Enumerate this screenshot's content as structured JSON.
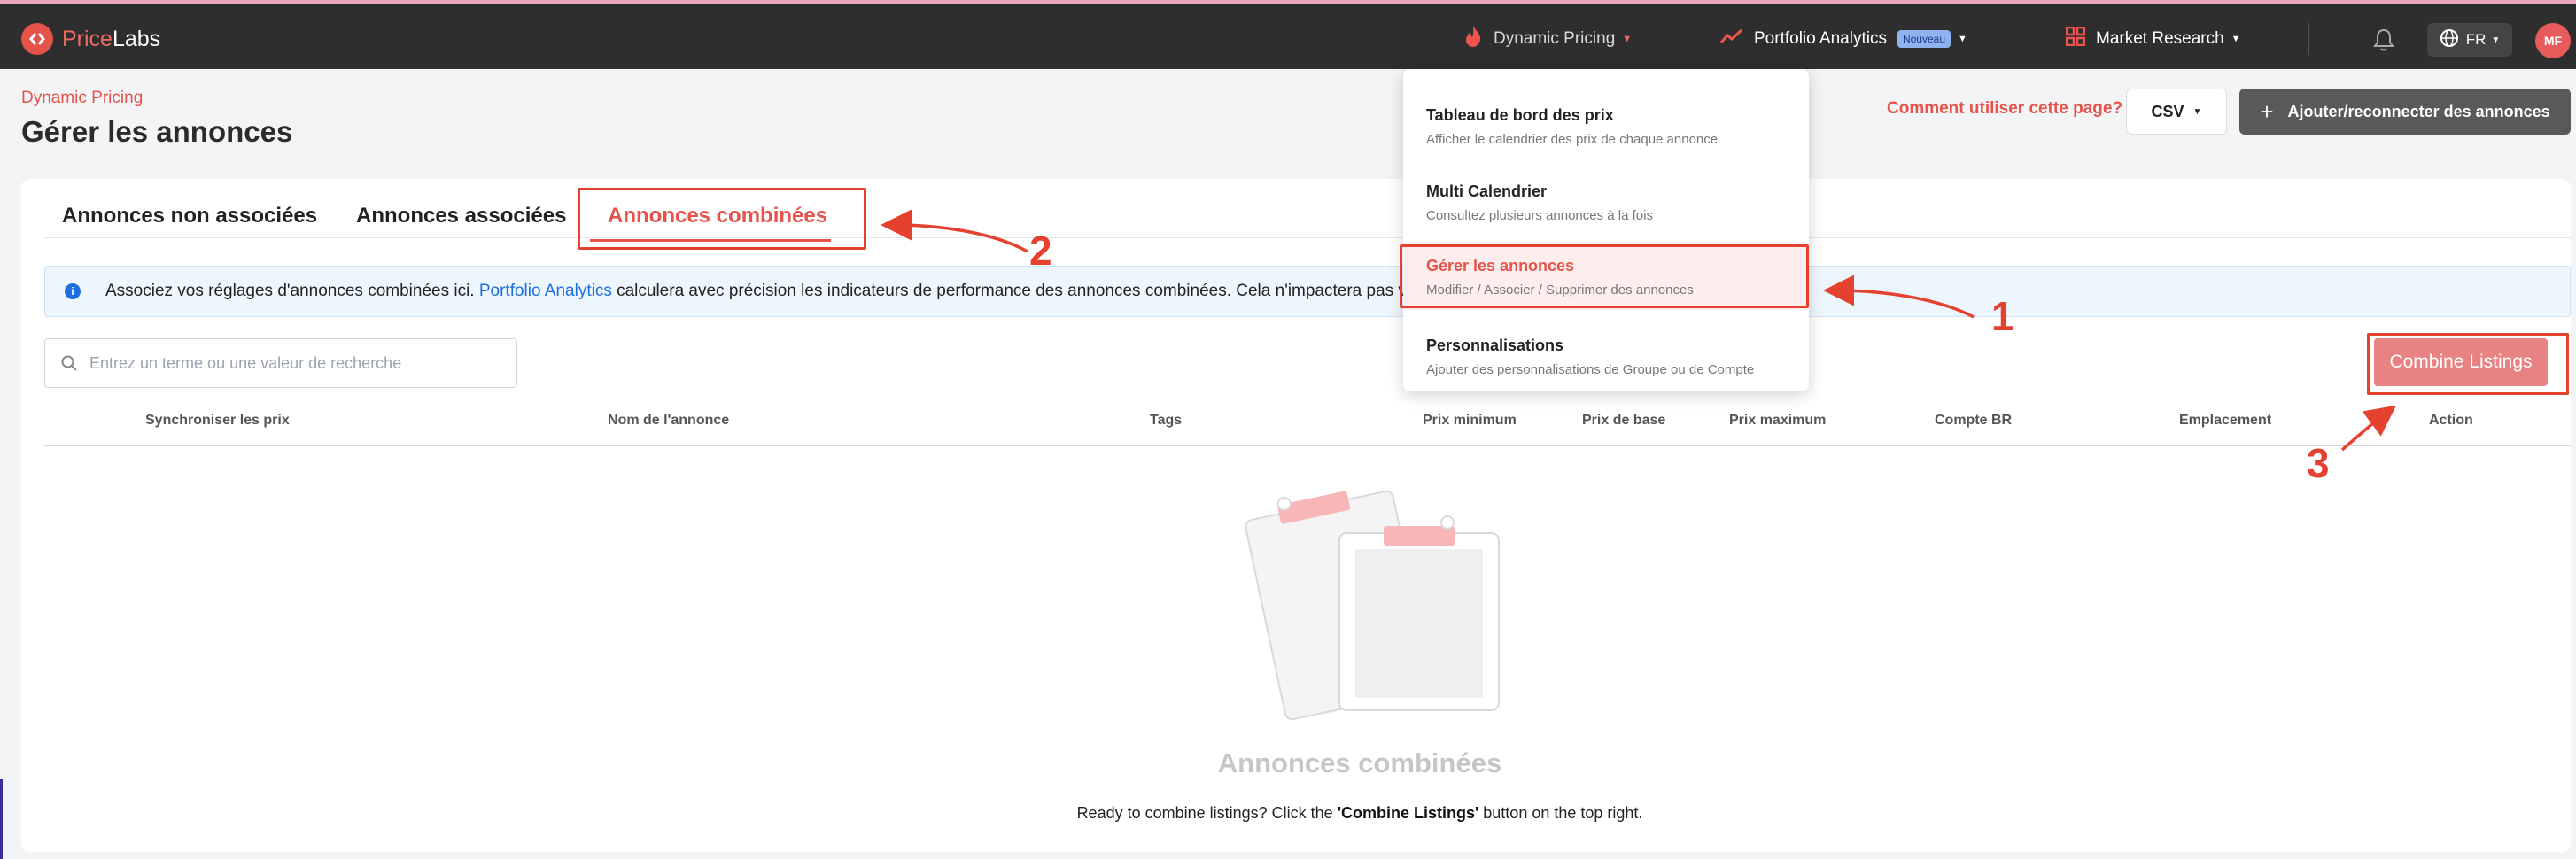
{
  "brand": {
    "name_prefix": "Price",
    "name_suffix": "Labs"
  },
  "topnav": {
    "dynamic_pricing": "Dynamic Pricing",
    "portfolio_analytics": "Portfolio Analytics",
    "portfolio_badge": "Nouveau",
    "market_research": "Market Research",
    "language": "FR",
    "avatar_initials": "MF"
  },
  "header": {
    "section": "Dynamic Pricing",
    "title": "Gérer les annonces",
    "help_link": "Comment utiliser cette page?",
    "csv_label": "CSV",
    "add_button": "Ajouter/reconnecter des annonces"
  },
  "tabs": [
    {
      "label": "Annonces non associées"
    },
    {
      "label": "Annonces associées"
    },
    {
      "label": "Annonces combinées",
      "active": true
    }
  ],
  "info": {
    "text_before": "Associez vos réglages d'annonces combinées ici. ",
    "link": "Portfolio Analytics",
    "text_after": " calculera avec précision les indicateurs de performance des annonces combinées. Cela n'impactera pas vos"
  },
  "search": {
    "placeholder": "Entrez un terme ou une valeur de recherche"
  },
  "combine_button": "Combine Listings",
  "table": {
    "columns": [
      "Synchroniser les prix",
      "Nom de l'annonce",
      "Tags",
      "Prix minimum",
      "Prix de base",
      "Prix maximum",
      "Compte BR",
      "Emplacement",
      "Action"
    ]
  },
  "empty_state": {
    "title": "Annonces combinées",
    "text_before": "Ready to combine listings? Click the ",
    "text_bold": "'Combine Listings'",
    "text_after": " button on the top right."
  },
  "dropdown": {
    "items": [
      {
        "title": "Tableau de bord des prix",
        "desc": "Afficher le calendrier des prix de chaque annonce"
      },
      {
        "title": "Multi Calendrier",
        "desc": "Consultez plusieurs annonces à la fois"
      },
      {
        "title": "Gérer les annonces",
        "desc": "Modifier / Associer / Supprimer des annonces",
        "active": true
      },
      {
        "title": "Personnalisations",
        "desc": "Ajouter des personnalisations de Groupe ou de Compte"
      }
    ]
  },
  "annotations": {
    "one": "1",
    "two": "2",
    "three": "3"
  },
  "colors": {
    "accent": "#e5534b",
    "annotation": "#e5412f",
    "topbar": "#2e2e2e",
    "link": "#1d6fe0"
  },
  "icons": [
    "logo-icon",
    "flame-icon",
    "trend-icon",
    "grid-icon",
    "bell-icon",
    "globe-icon",
    "chevron-down-icon",
    "info-icon",
    "search-icon",
    "plus-icon",
    "clipboard-icon"
  ]
}
